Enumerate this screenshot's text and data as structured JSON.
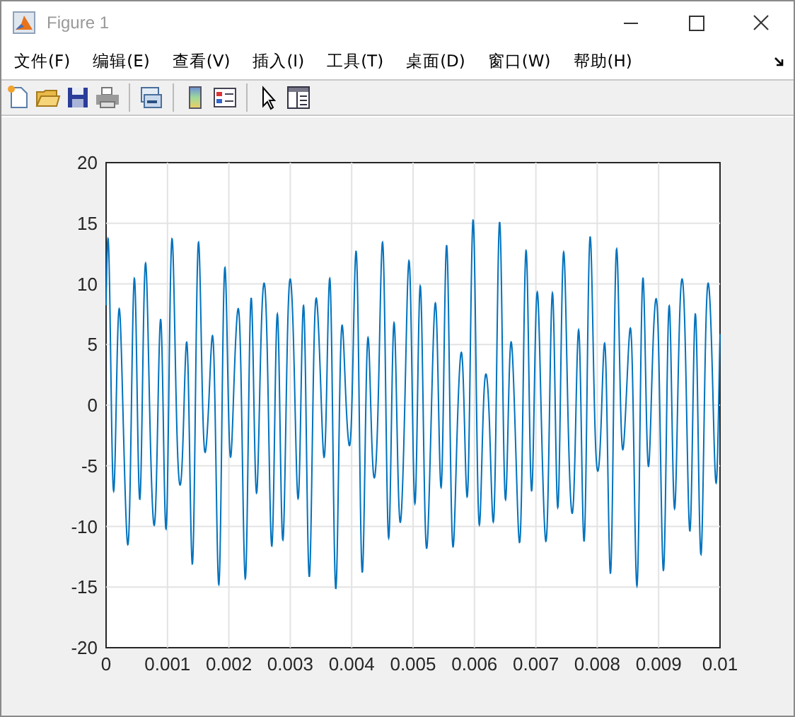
{
  "window": {
    "title": "Figure 1"
  },
  "menu": [
    {
      "label": "文件(F)"
    },
    {
      "label": "编辑(E)"
    },
    {
      "label": "查看(V)"
    },
    {
      "label": "插入(I)"
    },
    {
      "label": "工具(T)"
    },
    {
      "label": "桌面(D)"
    },
    {
      "label": "窗口(W)"
    },
    {
      "label": "帮助(H)"
    }
  ],
  "axes": {
    "yticks": [
      "20",
      "15",
      "10",
      "5",
      "0",
      "-5",
      "-10",
      "-15",
      "-20"
    ],
    "xticks": [
      "0",
      "0.001",
      "0.002",
      "0.003",
      "0.004",
      "0.005",
      "0.006",
      "0.007",
      "0.008",
      "0.009",
      "0.01"
    ]
  }
}
